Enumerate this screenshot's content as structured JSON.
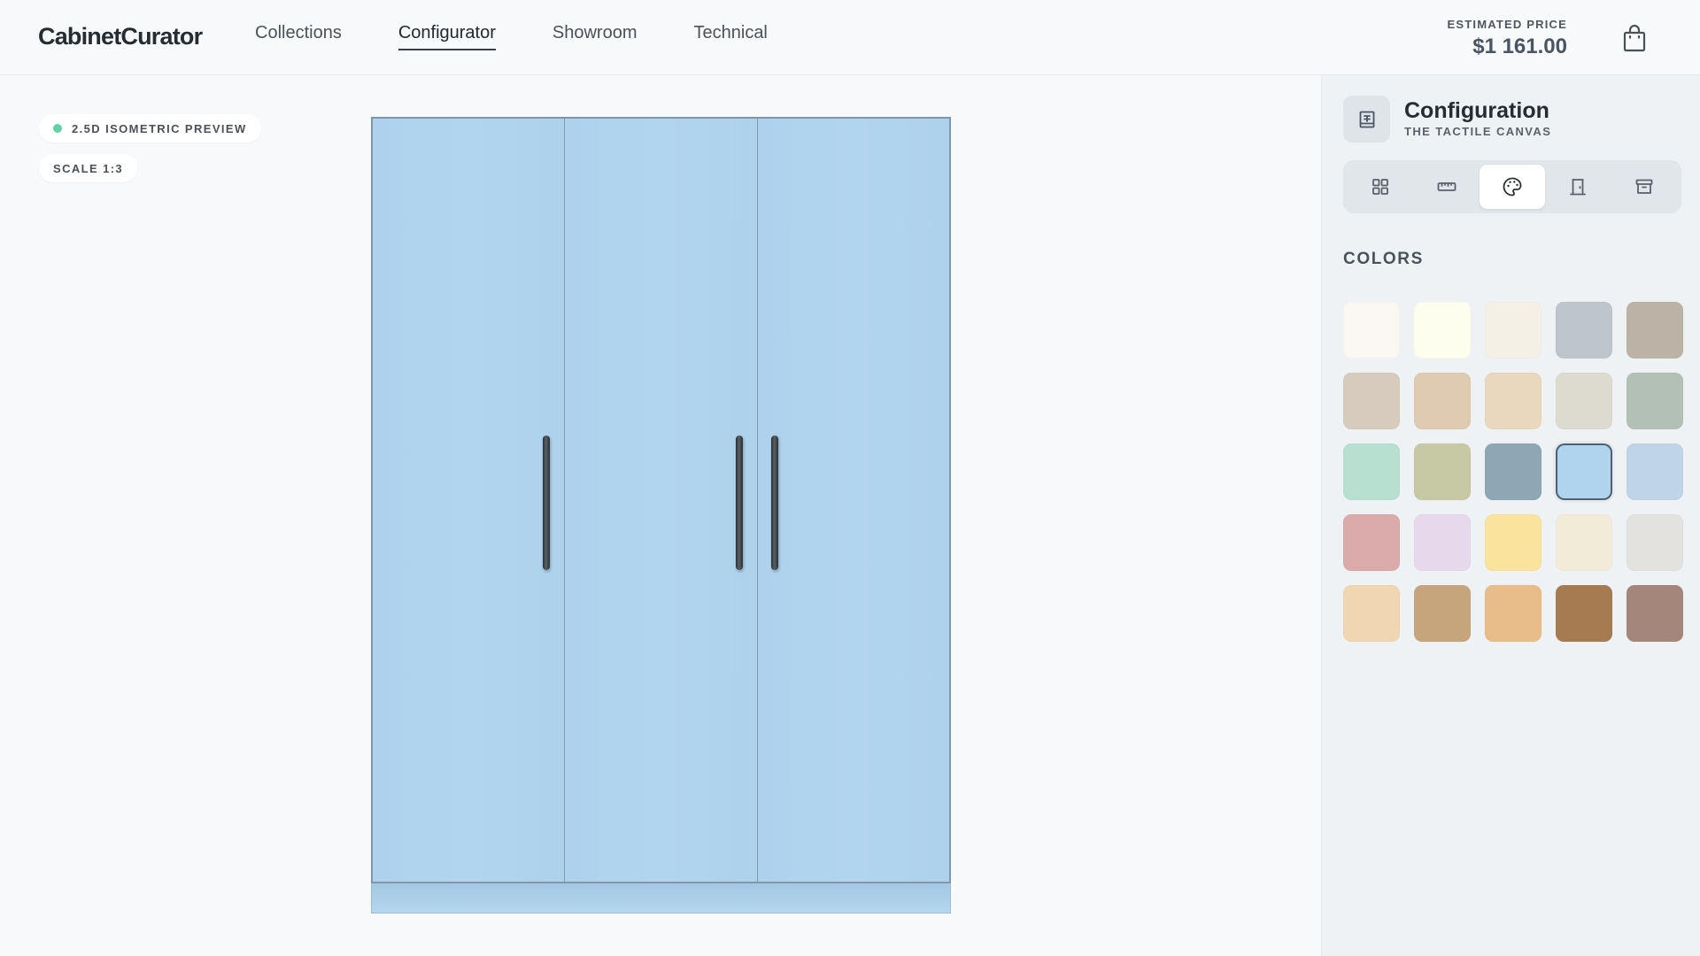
{
  "header": {
    "logo": "CabinetCurator",
    "nav": [
      {
        "label": "Collections",
        "active": false
      },
      {
        "label": "Configurator",
        "active": true
      },
      {
        "label": "Showroom",
        "active": false
      },
      {
        "label": "Technical",
        "active": false
      }
    ],
    "price_label": "ESTIMATED PRICE",
    "price_value": "$1 161.00",
    "cart_icon": "shopping-bag-icon"
  },
  "canvas": {
    "preview_badge": "2.5D ISOMETRIC PREVIEW",
    "scale_badge": "SCALE 1:3",
    "status_color": "#5fd3a3",
    "cabinet": {
      "door_count": 3,
      "color": "#b1d4ee"
    }
  },
  "sidebar": {
    "title": "Configuration",
    "subtitle": "THE TACTILE CANVAS",
    "title_icon": "book-icon",
    "tabs": [
      {
        "icon": "grid-icon",
        "active": false
      },
      {
        "icon": "ruler-icon",
        "active": false
      },
      {
        "icon": "palette-icon",
        "active": true
      },
      {
        "icon": "door-icon",
        "active": false
      },
      {
        "icon": "drawer-icon",
        "active": false
      }
    ],
    "section_title": "COLORS",
    "selected_index": 13,
    "swatches": [
      "#fbf8f3",
      "#fefeee",
      "#f4f0e6",
      "#bfc6cb",
      "#bcb2a6",
      "#d7cbbd",
      "#dfcab2",
      "#e9d8be",
      "#dddbd0",
      "#b3c0b5",
      "#b8e0d1",
      "#c7c9a4",
      "#8fa7b5",
      "#b1d4ee",
      "#c0d4e8",
      "#dbaaab",
      "#e8d8ec",
      "#f9e39d",
      "#f2ebd8",
      "#e4e2df",
      "#f0d6b1",
      "#c7a57c",
      "#e9bd89",
      "#a67b52",
      "#a4877a"
    ]
  }
}
